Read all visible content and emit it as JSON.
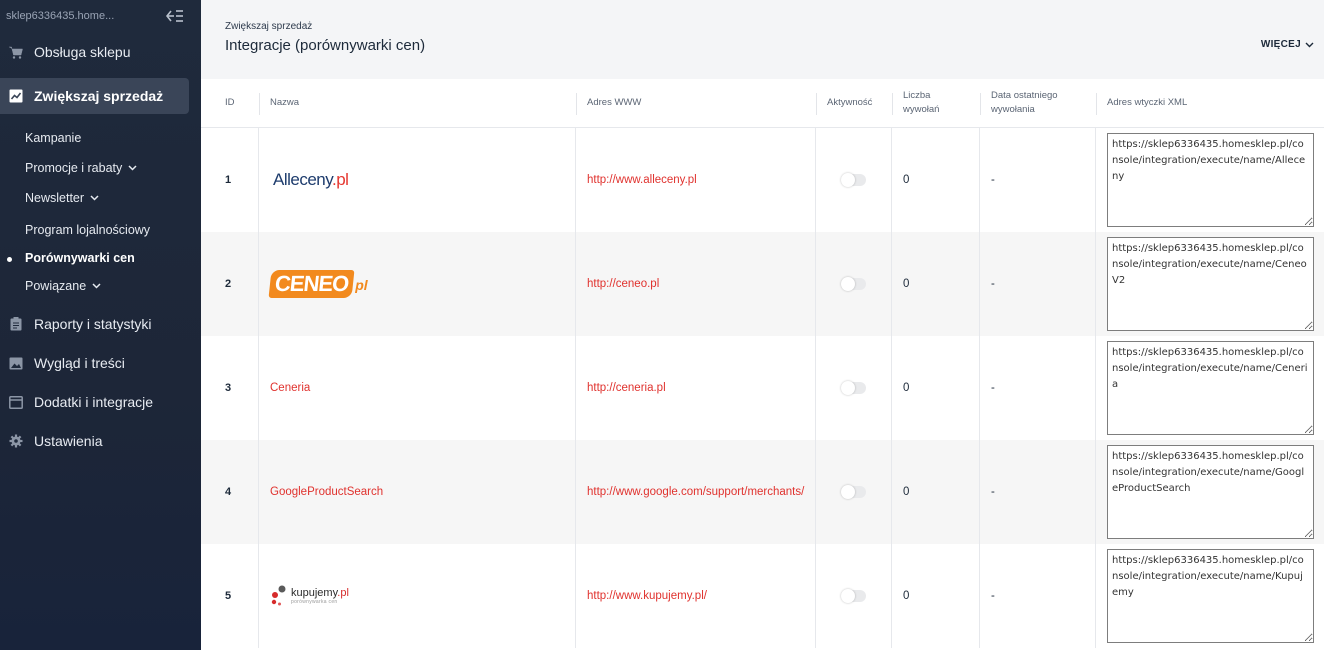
{
  "sidebar": {
    "shop_name": "sklep6336435.home...",
    "collapse_icon": "collapse-sidebar-icon",
    "items": [
      {
        "label": "Obsługa sklepu",
        "icon": "cart-icon"
      },
      {
        "label": "Zwiększaj sprzedaż",
        "icon": "chart-line-icon",
        "active": true
      },
      {
        "label": "Raporty i statystyki",
        "icon": "clipboard-icon"
      },
      {
        "label": "Wygląd i treści",
        "icon": "image-icon"
      },
      {
        "label": "Dodatki i integracje",
        "icon": "window-icon"
      },
      {
        "label": "Ustawienia",
        "icon": "gear-icon"
      }
    ],
    "subitems": [
      {
        "label": "Kampanie"
      },
      {
        "label": "Promocje i rabaty",
        "has_chevron": true
      },
      {
        "label": "Newsletter",
        "has_chevron": true
      },
      {
        "label": "Program lojalnościowy"
      },
      {
        "label": "Porównywarki cen",
        "current": true
      },
      {
        "label": "Powiązane",
        "has_chevron": true
      }
    ]
  },
  "header": {
    "breadcrumb": "Zwiększaj sprzedaż",
    "title": "Integracje (porównywarki cen)",
    "more_label": "WIĘCEJ"
  },
  "table": {
    "columns": {
      "id": "ID",
      "name": "Nazwa",
      "www": "Adres WWW",
      "active": "Aktywność",
      "calls_1": "Liczba",
      "calls_2": "wywołań",
      "last_1": "Data ostatniego",
      "last_2": "wywołania",
      "xml": "Adres wtyczki XML"
    },
    "rows": [
      {
        "id": "1",
        "name": "Alleceny.pl",
        "logo": "alleceny",
        "www": "http://www.alleceny.pl",
        "active": false,
        "calls": "0",
        "last": "-",
        "xml": "https://sklep6336435.homesklep.pl/console/integration/execute/name/Alleceny"
      },
      {
        "id": "2",
        "name": "CENEO.pl",
        "logo": "ceneo",
        "www": "http://ceneo.pl",
        "active": false,
        "calls": "0",
        "last": "-",
        "xml": "https://sklep6336435.homesklep.pl/console/integration/execute/name/CeneoV2"
      },
      {
        "id": "3",
        "name": "Ceneria",
        "logo": "",
        "www": "http://ceneria.pl",
        "active": false,
        "calls": "0",
        "last": "-",
        "xml": "https://sklep6336435.homesklep.pl/console/integration/execute/name/Ceneria"
      },
      {
        "id": "4",
        "name": "GoogleProductSearch",
        "logo": "",
        "www": "http://www.google.com/support/merchants/",
        "active": false,
        "calls": "0",
        "last": "-",
        "xml": "https://sklep6336435.homesklep.pl/console/integration/execute/name/GoogleProductSearch"
      },
      {
        "id": "5",
        "name": "kupujemy.pl",
        "logo": "kupujemy",
        "logo_sub": "porównywarka cen",
        "www": "http://www.kupujemy.pl/",
        "active": false,
        "calls": "0",
        "last": "-",
        "xml": "https://sklep6336435.homesklep.pl/console/integration/execute/name/Kupujemy"
      }
    ]
  },
  "colors": {
    "accent_link": "#e0322e",
    "sidebar_bg": "#1f2a3c",
    "ceneo_orange": "#f28a1e"
  }
}
